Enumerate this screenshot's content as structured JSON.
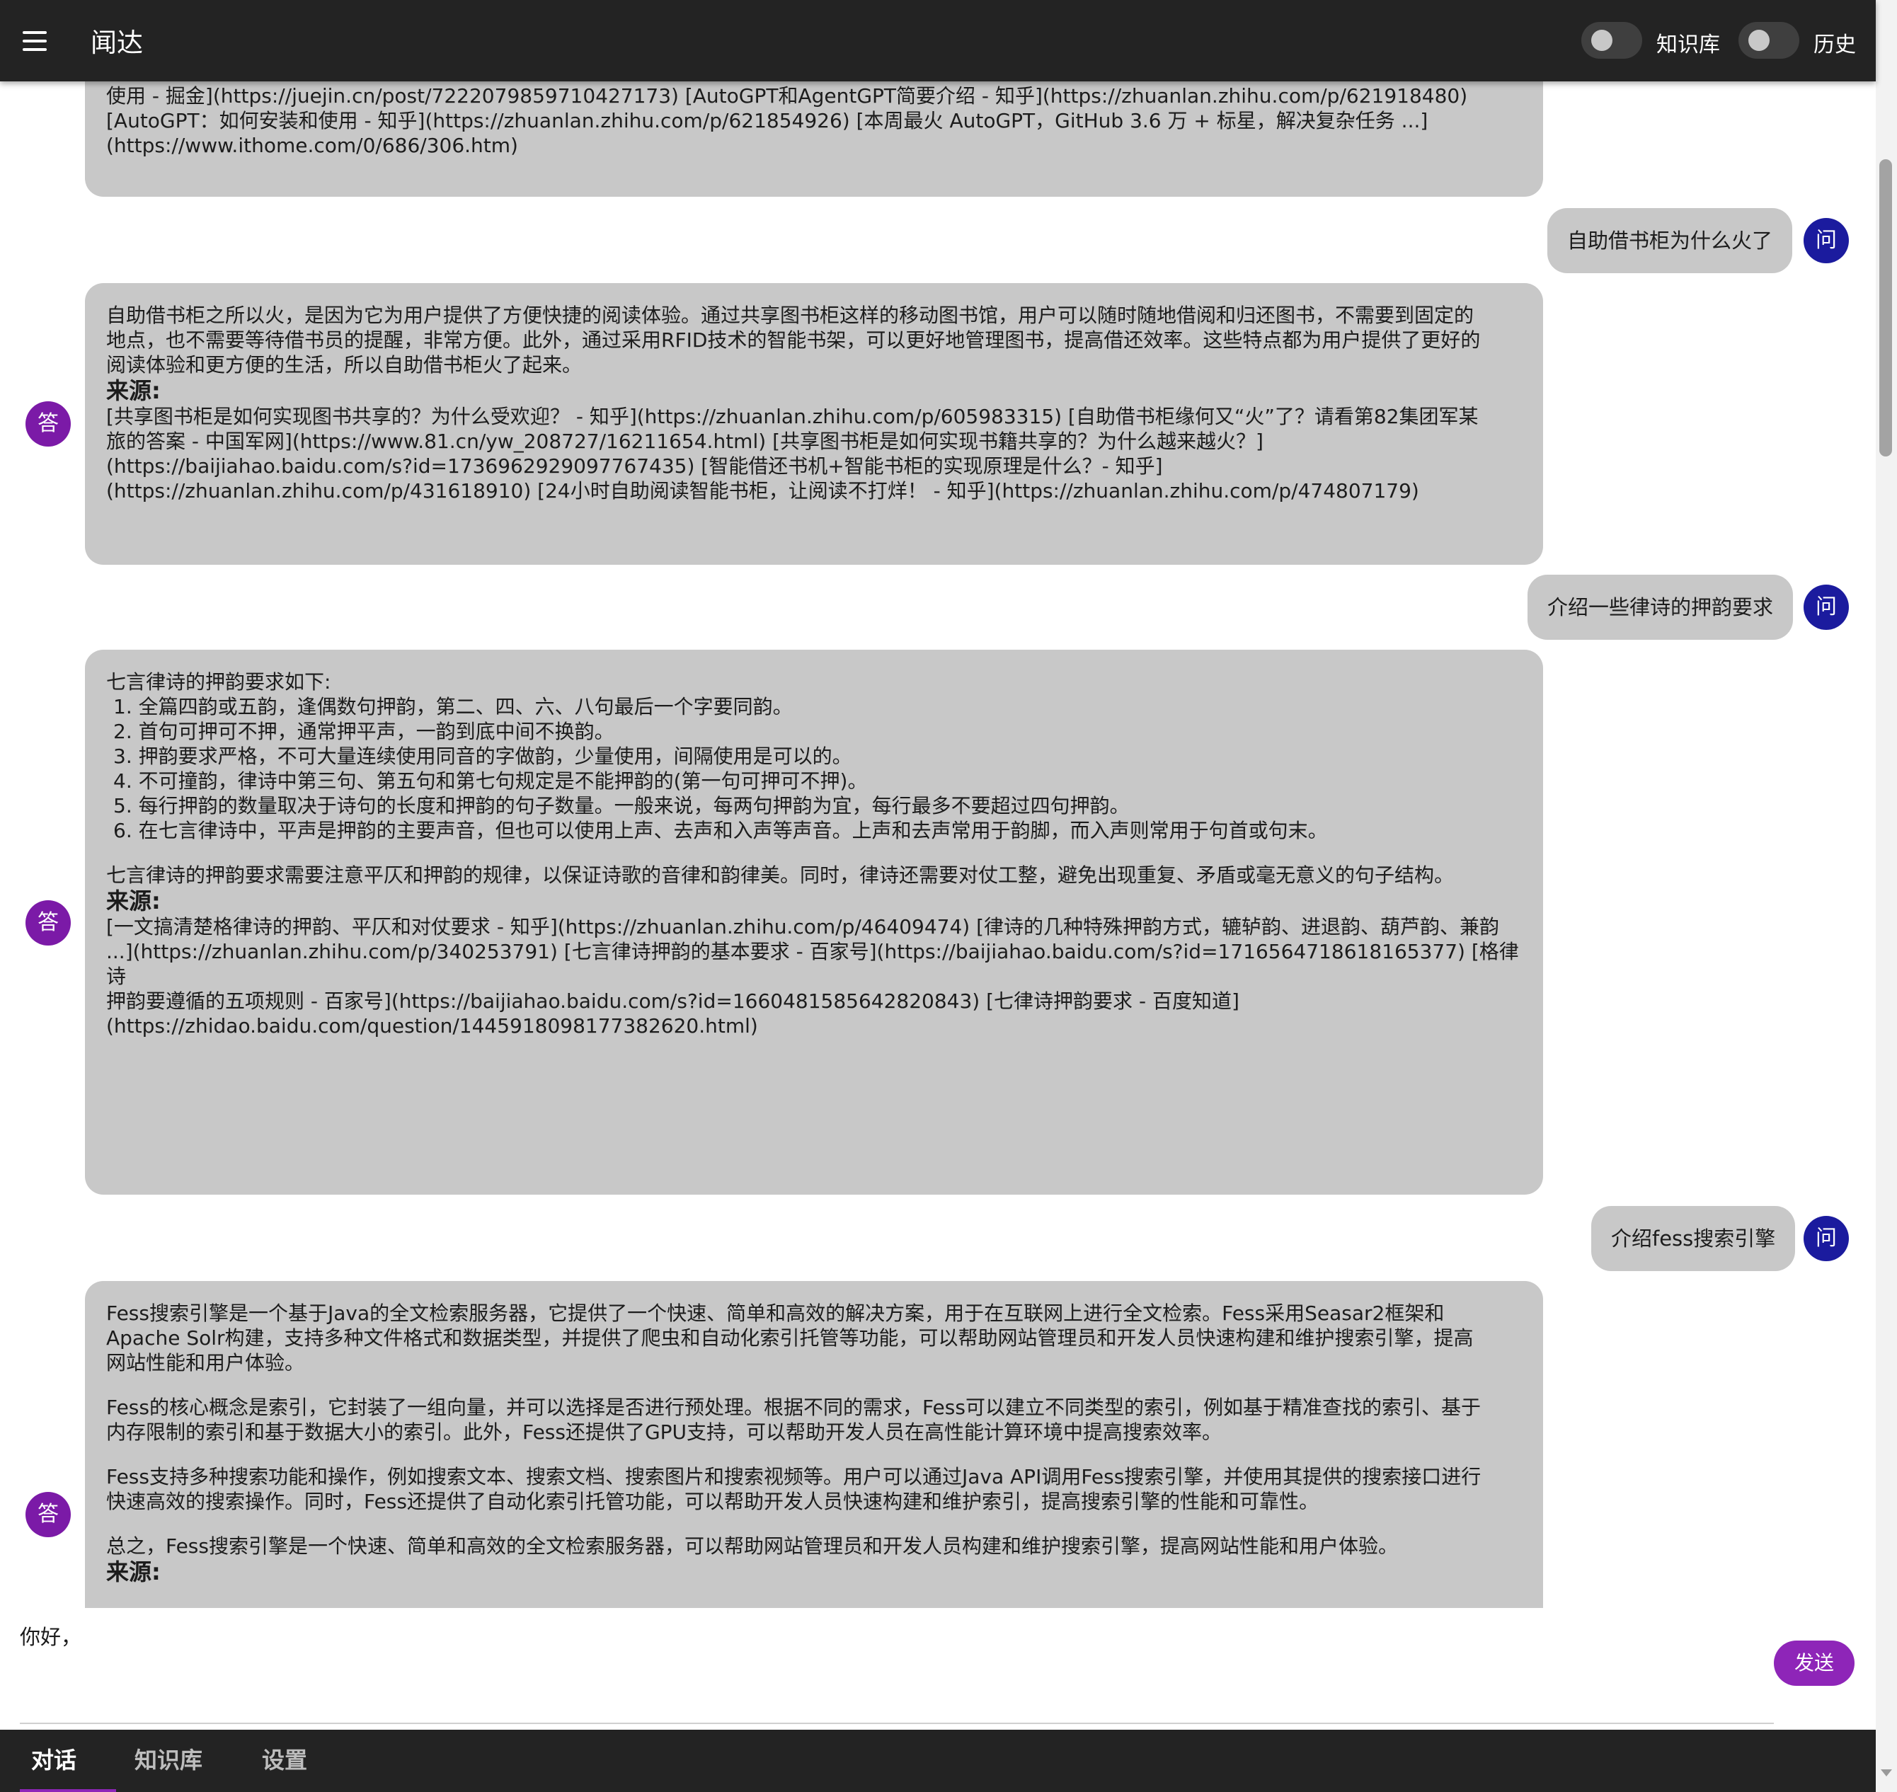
{
  "app": {
    "title": "闻达"
  },
  "header": {
    "toggles": [
      {
        "label": "知识库",
        "on": false
      },
      {
        "label": "历史",
        "on": false
      }
    ]
  },
  "avatars": {
    "question": "问",
    "answer": "答"
  },
  "messages": {
    "a0": {
      "lines": [
        "使用 - 掘金](https://juejin.cn/post/7222079859710427173) [AutoGPT和AgentGPT简要介绍 - 知乎](https://zhuanlan.zhihu.com/p/621918480)",
        "[AutoGPT：如何安装和使用 - 知乎](https://zhuanlan.zhihu.com/p/621854926) [本周最火 AutoGPT，GitHub 3.6 万 + 标星，解决复杂任务 ...]",
        "(https://www.ithome.com/0/686/306.htm)"
      ]
    },
    "q1": "自助借书柜为什么火了",
    "a1": {
      "body": [
        "自助借书柜之所以火，是因为它为用户提供了方便快捷的阅读体验。通过共享图书柜这样的移动图书馆，用户可以随时随地借阅和归还图书，不需要到固定的",
        "地点，也不需要等待借书员的提醒，非常方便。此外，通过采用RFID技术的智能书架，可以更好地管理图书，提高借还效率。这些特点都为用户提供了更好的",
        "阅读体验和更方便的生活，所以自助借书柜火了起来。"
      ],
      "source_title": "来源:",
      "sources": [
        "[共享图书柜是如何实现图书共享的？为什么受欢迎？ - 知乎](https://zhuanlan.zhihu.com/p/605983315) [自助借书柜缘何又“火”了？请看第82集团军某",
        "旅的答案 - 中国军网](https://www.81.cn/yw_208727/16211654.html) [共享图书柜是如何实现书籍共享的？为什么越来越火？]",
        "(https://baijiahao.baidu.com/s?id=1736962929097767435) [智能借还书机+智能书柜的实现原理是什么？- 知乎]",
        "(https://zhuanlan.zhihu.com/p/431618910) [24小时自助阅读智能书柜，让阅读不打烊！ - 知乎](https://zhuanlan.zhihu.com/p/474807179)"
      ]
    },
    "q2": "介绍一些律诗的押韵要求",
    "a2": {
      "intro": "七言律诗的押韵要求如下:",
      "items": [
        "1. 全篇四韵或五韵，逢偶数句押韵，第二、四、六、八句最后一个字要同韵。",
        "2. 首句可押可不押，通常押平声，一韵到底中间不换韵。",
        "3. 押韵要求严格，不可大量连续使用同音的字做韵，少量使用，间隔使用是可以的。",
        "4. 不可撞韵，律诗中第三句、第五句和第七句规定是不能押韵的(第一句可押可不押)。",
        "5. 每行押韵的数量取决于诗句的长度和押韵的句子数量。一般来说，每两句押韵为宜，每行最多不要超过四句押韵。",
        "6. 在七言律诗中，平声是押韵的主要声音，但也可以使用上声、去声和入声等声音。上声和去声常用于韵脚，而入声则常用于句首或句末。"
      ],
      "outro": "七言律诗的押韵要求需要注意平仄和押韵的规律，以保证诗歌的音律和韵律美。同时，律诗还需要对仗工整，避免出现重复、矛盾或毫无意义的句子结构。",
      "source_title": "来源:",
      "sources": [
        "[一文搞清楚格律诗的押韵、平仄和对仗要求 - 知乎](https://zhuanlan.zhihu.com/p/46409474) [律诗的几种特殊押韵方式，辘轳韵、进退韵、葫芦韵、兼韵",
        "...](https://zhuanlan.zhihu.com/p/340253791) [七言律诗押韵的基本要求 - 百家号](https://baijiahao.baidu.com/s?id=1716564718618165377) [格律诗",
        "押韵要遵循的五项规则 - 百家号](https://baijiahao.baidu.com/s?id=1660481585642820843) [七律诗押韵要求 - 百度知道]",
        "(https://zhidao.baidu.com/question/1445918098177382620.html)"
      ]
    },
    "q3": "介绍fess搜索引擎",
    "a3": {
      "paragraphs": [
        [
          "Fess搜索引擎是一个基于Java的全文检索服务器，它提供了一个快速、简单和高效的解决方案，用于在互联网上进行全文检索。Fess采用Seasar2框架和",
          "Apache Solr构建，支持多种文件格式和数据类型，并提供了爬虫和自动化索引托管等功能，可以帮助网站管理员和开发人员快速构建和维护搜索引擎，提高",
          "网站性能和用户体验。"
        ],
        [
          "Fess的核心概念是索引，它封装了一组向量，并可以选择是否进行预处理。根据不同的需求，Fess可以建立不同类型的索引，例如基于精准查找的索引、基于",
          "内存限制的索引和基于数据大小的索引。此外，Fess还提供了GPU支持，可以帮助开发人员在高性能计算环境中提高搜索效率。"
        ],
        [
          "Fess支持多种搜索功能和操作，例如搜索文本、搜索文档、搜索图片和搜索视频等。用户可以通过Java API调用Fess搜索引擎，并使用其提供的搜索接口进行",
          "快速高效的搜索操作。同时，Fess还提供了自动化索引托管功能，可以帮助开发人员快速构建和维护索引，提高搜索引擎的性能和可靠性。"
        ],
        [
          "总之，Fess搜索引擎是一个快速、简单和高效的全文检索服务器，可以帮助网站管理员和开发人员构建和维护搜索引擎，提高网站性能和用户体验。"
        ]
      ],
      "source_title": "来源:"
    }
  },
  "input": {
    "value": "你好，"
  },
  "send_label": "发送",
  "tabs": [
    {
      "label": "对话",
      "active": true
    },
    {
      "label": "知识库",
      "active": false
    },
    {
      "label": "设置",
      "active": false
    }
  ],
  "colors": {
    "bar": "#232323",
    "bubble": "#c8c8c8",
    "avatar_question": "#1b1b9e",
    "avatar_answer": "#7b1aa7",
    "accent": "#8e25b8"
  }
}
